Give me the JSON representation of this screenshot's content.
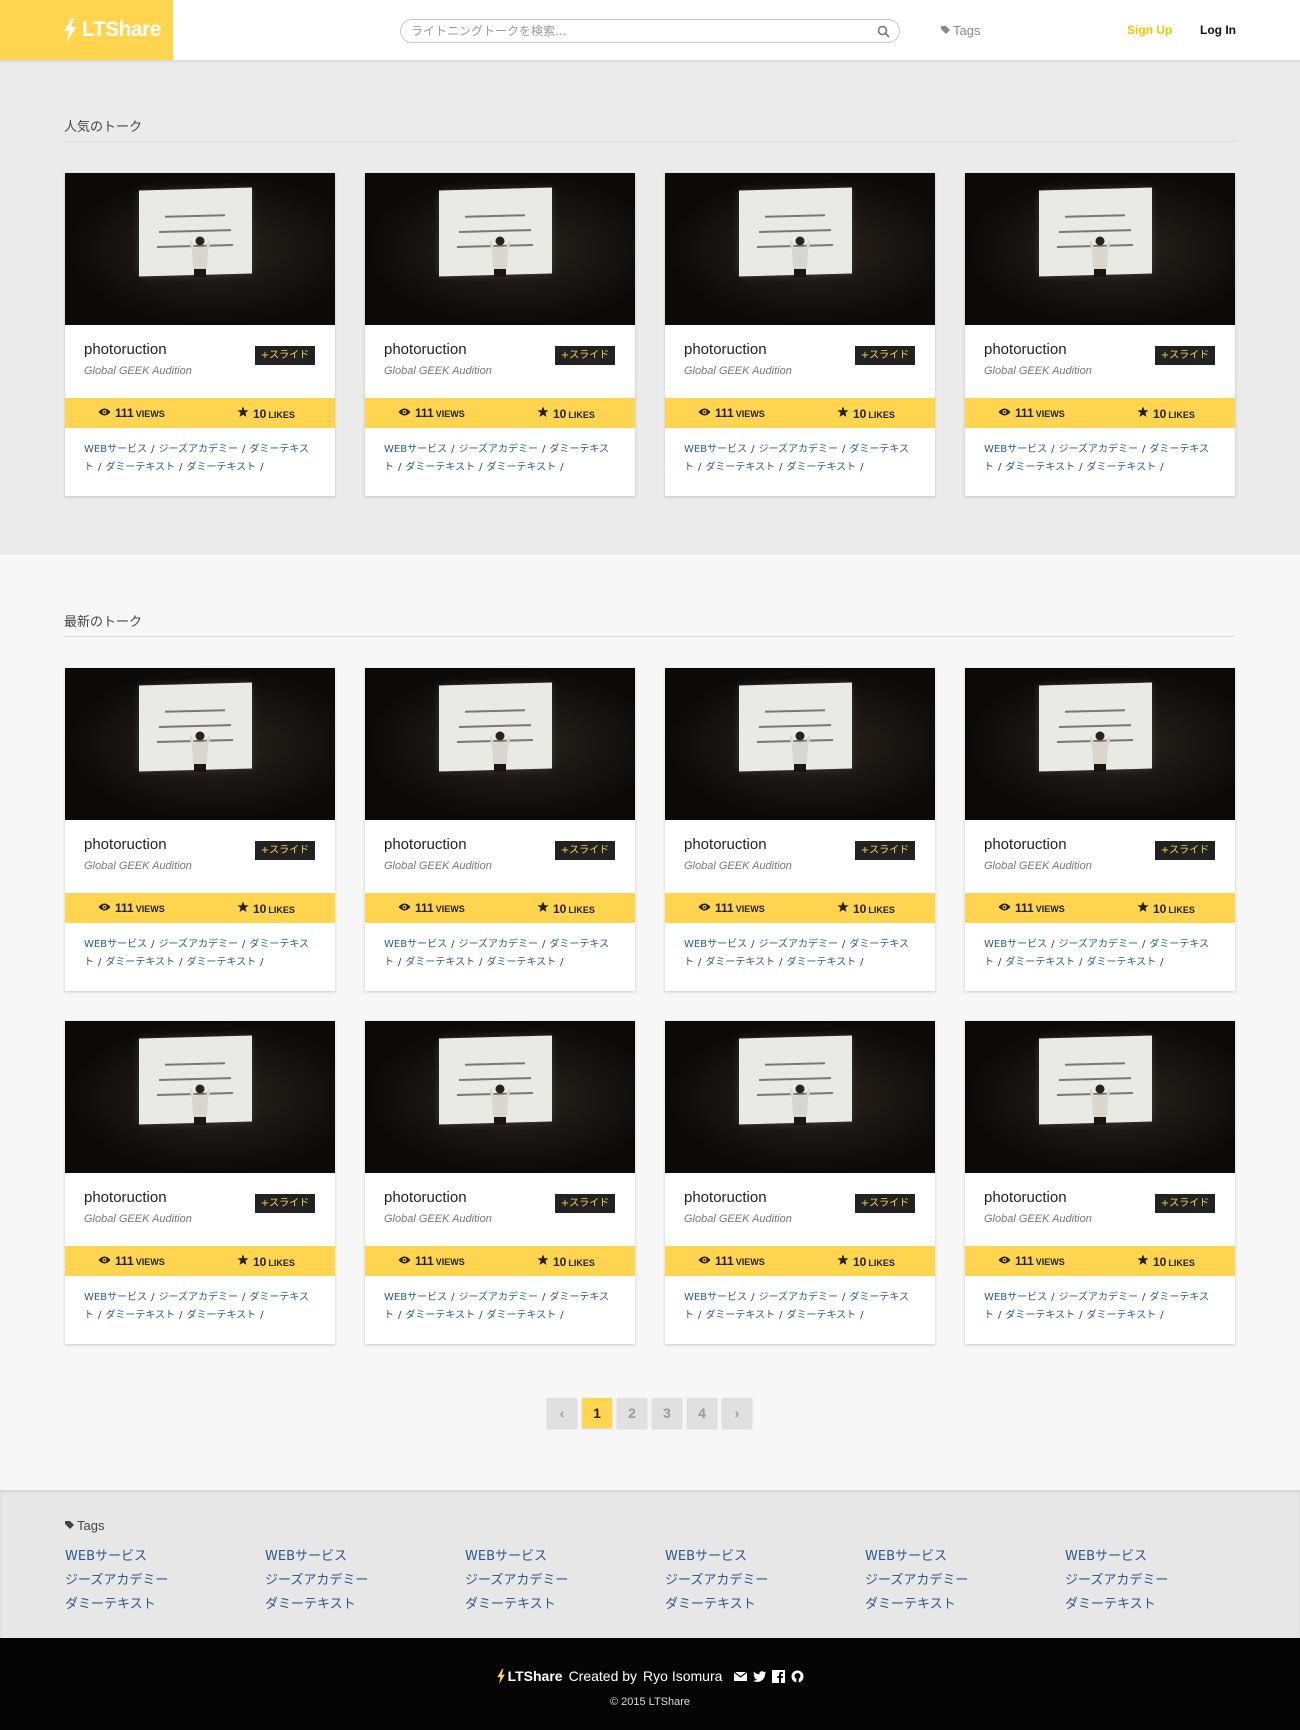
{
  "header": {
    "logo_text": "LTShare",
    "search_placeholder": "ライトニングトークを検索...",
    "tags_label": "Tags",
    "signup_label": "Sign Up",
    "login_label": "Log In"
  },
  "sections": {
    "popular_title": "人気のトーク",
    "latest_title": "最新のトーク"
  },
  "card_template": {
    "title": "photoruction",
    "subtitle": "Global GEEK Audition",
    "badge": "+スライド",
    "views": "111",
    "views_unit": "VIEWS",
    "likes": "10",
    "likes_unit": "LIKES",
    "tags": [
      "WEBサービス",
      "ジーズアカデミー",
      "ダミーテキスト",
      "ダミーテキスト",
      "ダミーテキスト"
    ]
  },
  "pagination": {
    "prev": "‹",
    "pages": [
      "1",
      "2",
      "3",
      "4"
    ],
    "current": "1",
    "next": "›"
  },
  "footer_tags": {
    "title": "Tags",
    "columns": [
      [
        "WEBサービス",
        "ジーズアカデミー",
        "ダミーテキスト"
      ],
      [
        "WEBサービス",
        "ジーズアカデミー",
        "ダミーテキスト"
      ],
      [
        "WEBサービス",
        "ジーズアカデミー",
        "ダミーテキスト"
      ],
      [
        "WEBサービス",
        "ジーズアカデミー",
        "ダミーテキスト"
      ],
      [
        "WEBサービス",
        "ジーズアカデミー",
        "ダミーテキスト"
      ],
      [
        "WEBサービス",
        "ジーズアカデミー",
        "ダミーテキスト"
      ]
    ]
  },
  "footer": {
    "brand": "LTShare",
    "created_by": "Created by",
    "author": "Ryo Isomura",
    "copyright": "© 2015 LTShare",
    "social_icons": [
      "mail-icon",
      "twitter-icon",
      "facebook-icon",
      "github-icon"
    ]
  },
  "colors": {
    "accent": "#ffd54f",
    "link": "#2d5a88",
    "badge_bg": "#222222",
    "signup": "#f5c400"
  }
}
